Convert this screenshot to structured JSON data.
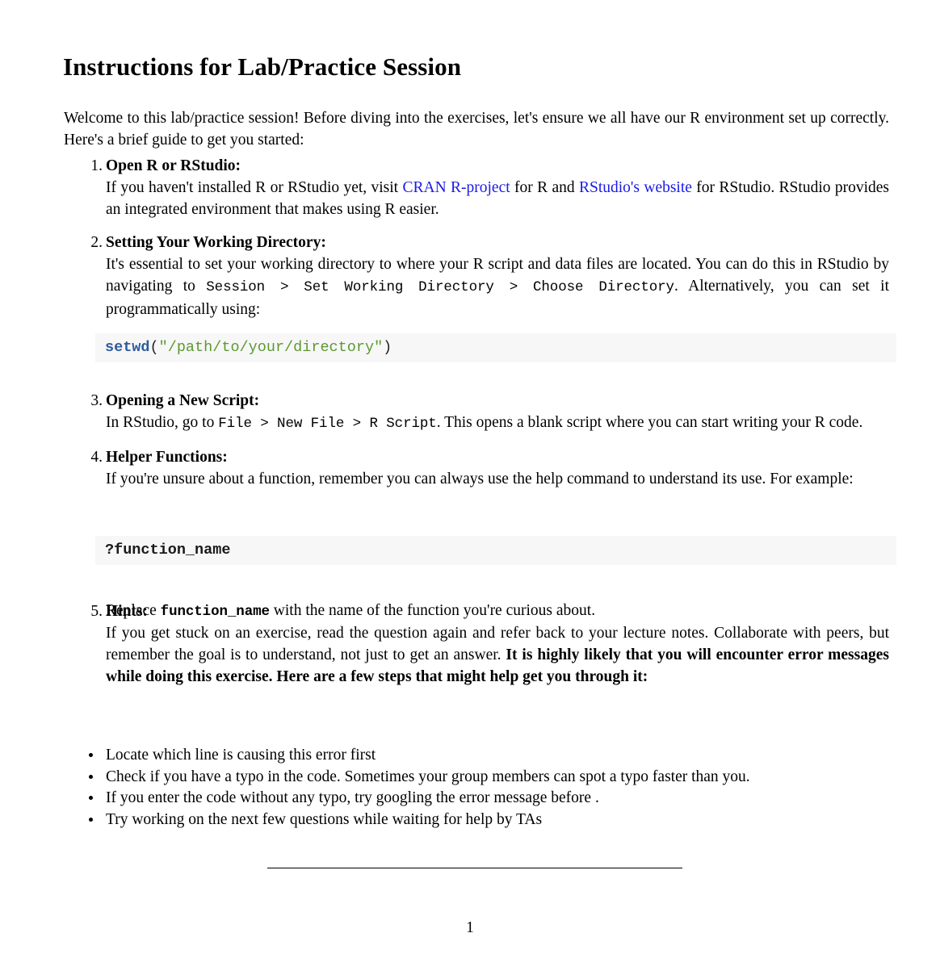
{
  "document": {
    "title": "Instructions for Lab/Practice Session",
    "intro": "Welcome to this lab/practice session! Before diving into the exercises, let's ensure we all have our R environment set up correctly. Here's a brief guide to get you started:",
    "page_number": "1"
  },
  "numbered_items": [
    {
      "number": "1.",
      "heading": "Open R or RStudio:",
      "body_part1": "If you haven't installed R or RStudio yet, visit ",
      "link1": "CRAN R-project",
      "body_part2": " for R and ",
      "link2": "RStudio's website",
      "body_part3": " for RStudio. RStudio provides an integrated environment that makes using R easier."
    },
    {
      "number": "2.",
      "heading": "Setting Your Working Directory:",
      "body_part1": "It's essential to set your working directory to where your R script and data files are located. You can do this in RStudio by navigating to ",
      "code1": "Session > Set Working Directory > Choose Directory",
      "body_part2": ". Alternatively, you can set it programmatically using:"
    },
    {
      "number": "3.",
      "heading": "Opening a New Script:",
      "body_part1": "In RStudio, go to ",
      "code1": "File > New File > R Script",
      "body_part2": ". This opens a blank script where you can start writing your R code."
    },
    {
      "number": "4.",
      "heading": "Helper Functions:",
      "body_part1": "If you're unsure about a function, remember you can always use the help command to understand its use. For example:"
    },
    {
      "number": "5.",
      "heading": "Hints:",
      "body_part1": "If you get stuck on an exercise, read the question again and refer back to your lecture notes. Collaborate with peers, but remember the goal is to understand, not just to get an answer. ",
      "body_bold": "It is highly likely that you will encounter error messages while doing this exercise. Here are a few steps that might help get you through it:"
    }
  ],
  "code_blocks": {
    "setwd": {
      "function": "setwd",
      "open_paren": "(",
      "string": "\"/path/to/your/directory\"",
      "close_paren": ")"
    },
    "help": {
      "text": "?function_name"
    }
  },
  "replace_paragraph": {
    "part1": "Replace ",
    "code": "function_name",
    "part2": " with the name of the function you're curious about."
  },
  "bullets": [
    "Locate which line is causing this error first",
    "Check if you have a typo in the code. Sometimes your group members can spot a typo faster than you.",
    "If you enter the code without any typo, try googling the error message before .",
    "Try working on the next few questions while waiting for help by TAs"
  ],
  "colors": {
    "link": "#1a1ae6",
    "code_background": "#f7f7f7",
    "code_function": "#2d5c9e",
    "code_string": "#5c9931",
    "text": "#000000"
  }
}
